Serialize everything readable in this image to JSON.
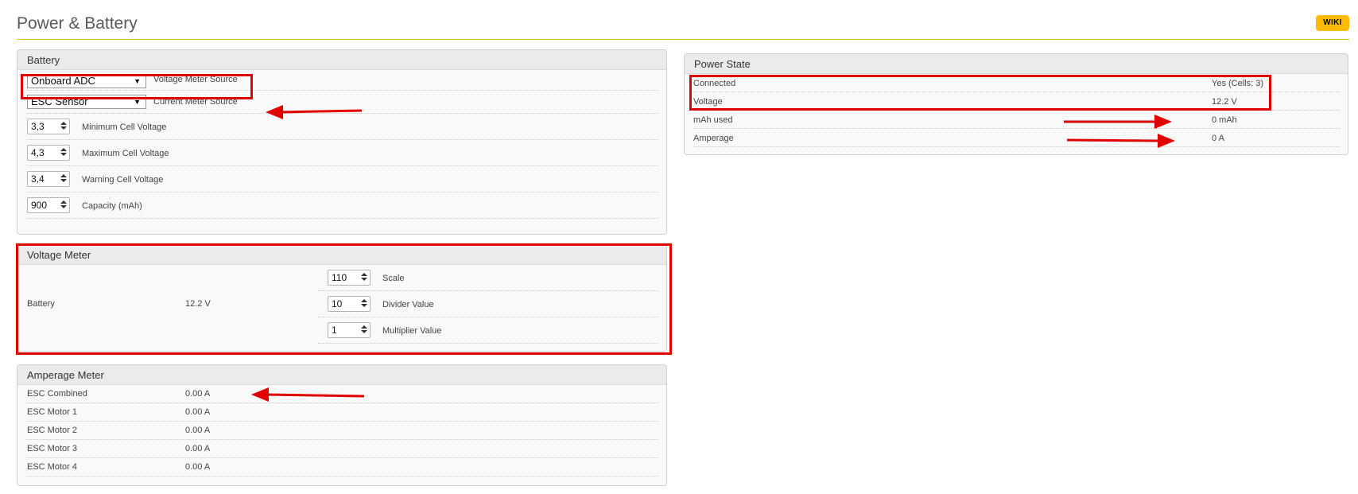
{
  "page": {
    "title": "Power & Battery",
    "wiki_label": "WIKI"
  },
  "battery": {
    "title": "Battery",
    "voltage_meter_source": {
      "value": "Onboard ADC",
      "label": "Voltage Meter Source"
    },
    "current_meter_source": {
      "value": "ESC Sensor",
      "label": "Current Meter Source"
    },
    "min_cell": {
      "value": "3,3",
      "label": "Minimum Cell Voltage"
    },
    "max_cell": {
      "value": "4,3",
      "label": "Maximum Cell Voltage"
    },
    "warn_cell": {
      "value": "3,4",
      "label": "Warning Cell Voltage"
    },
    "capacity": {
      "value": "900",
      "label": "Capacity (mAh)"
    }
  },
  "voltage_meter": {
    "title": "Voltage Meter",
    "name": "Battery",
    "reading": "12.2 V",
    "scale": {
      "value": "110",
      "label": "Scale"
    },
    "divider": {
      "value": "10",
      "label": "Divider Value"
    },
    "multiplier": {
      "value": "1",
      "label": "Multiplier Value"
    }
  },
  "amperage_meter": {
    "title": "Amperage Meter",
    "rows": [
      {
        "name": "ESC Combined",
        "value": "0.00 A"
      },
      {
        "name": "ESC Motor 1",
        "value": "0.00 A"
      },
      {
        "name": "ESC Motor 2",
        "value": "0.00 A"
      },
      {
        "name": "ESC Motor 3",
        "value": "0.00 A"
      },
      {
        "name": "ESC Motor 4",
        "value": "0.00 A"
      }
    ]
  },
  "power_state": {
    "title": "Power State",
    "rows": [
      {
        "name": "Connected",
        "value": "Yes (Cells: 3)"
      },
      {
        "name": "Voltage",
        "value": "12.2 V"
      },
      {
        "name": "mAh used",
        "value": "0 mAh"
      },
      {
        "name": "Amperage",
        "value": "0 A"
      }
    ]
  },
  "colors": {
    "accent": "#ffbb00",
    "annotation": "#e00000",
    "header_rule": "#e6c200"
  }
}
